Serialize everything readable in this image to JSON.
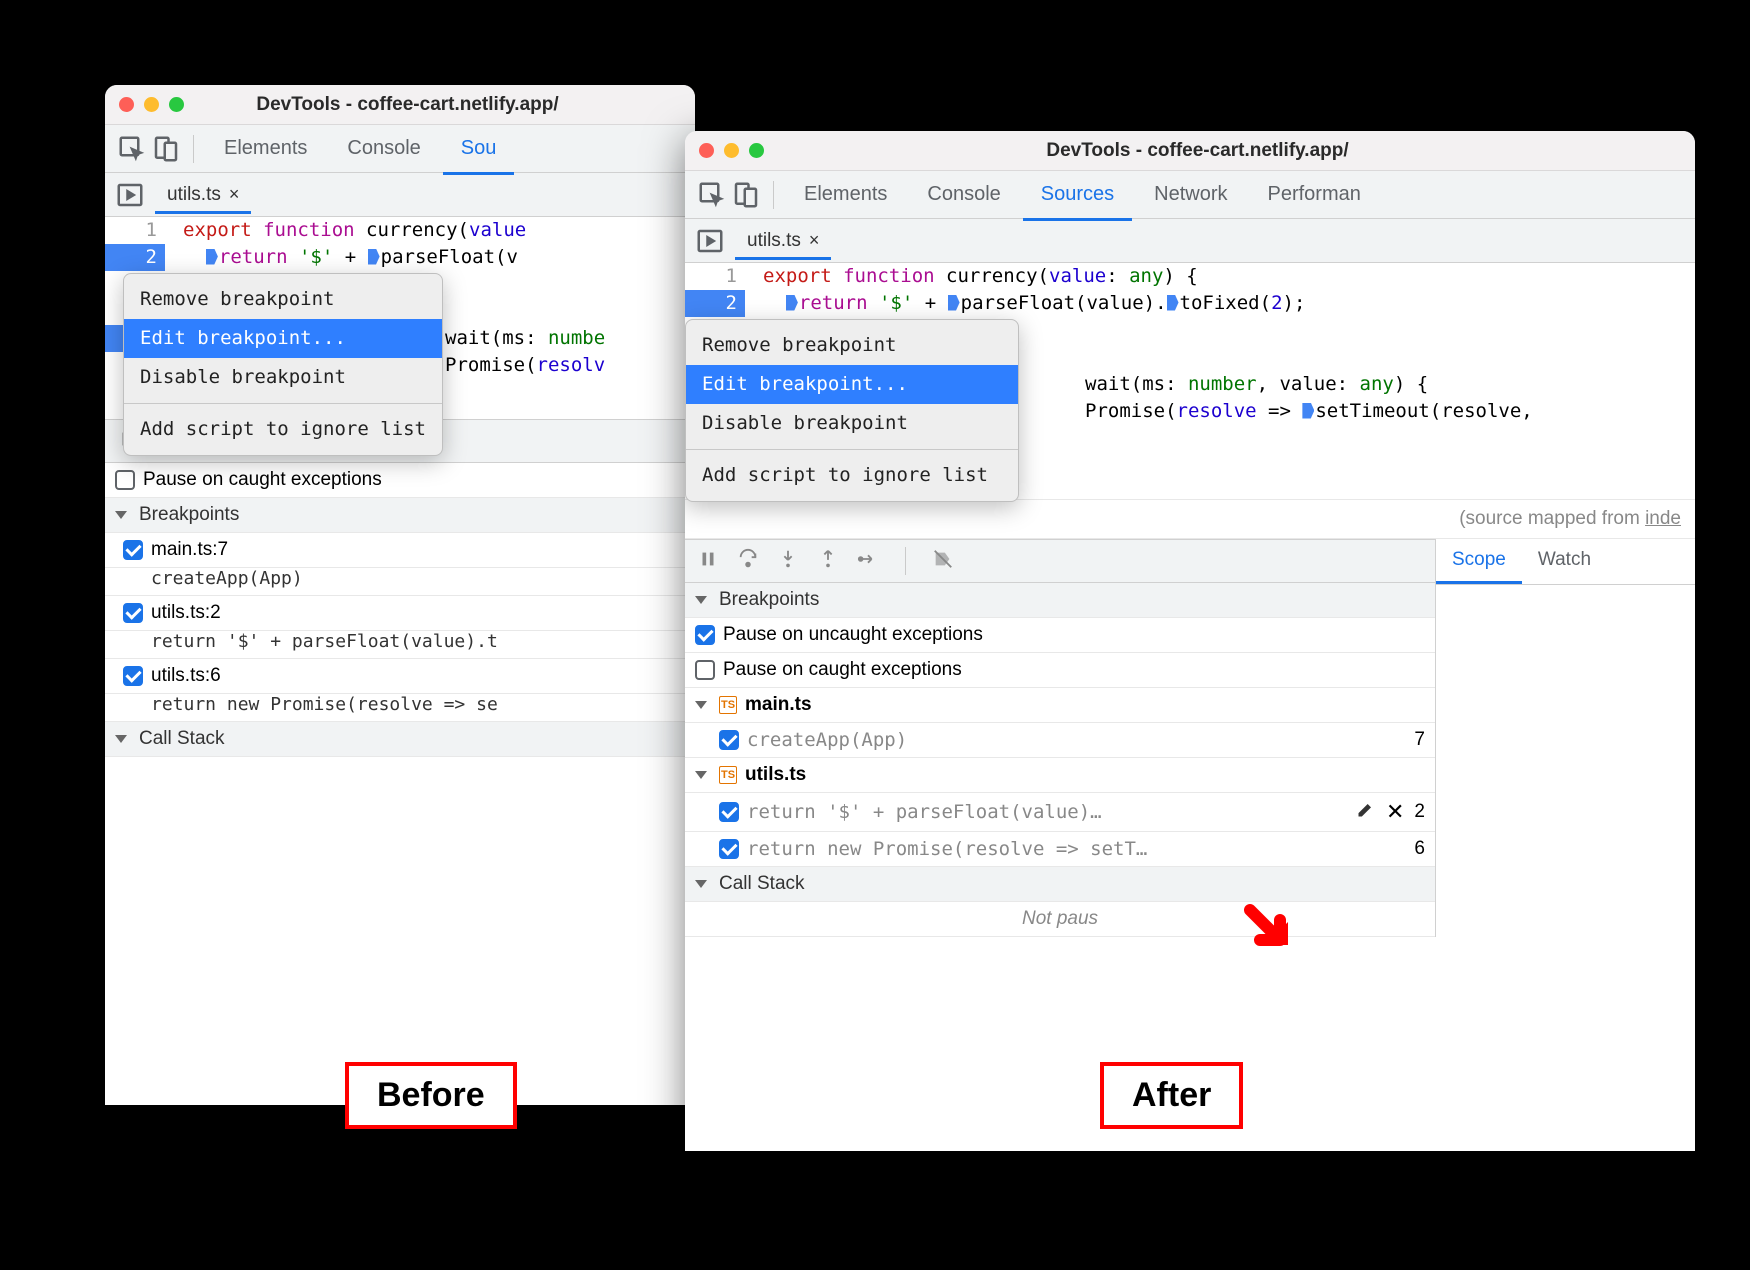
{
  "before": {
    "title": "DevTools - coffee-cart.netlify.app/",
    "tabs": [
      "Elements",
      "Console",
      "Sou"
    ],
    "file_tab": "utils.ts",
    "code": {
      "line1": {
        "num": "1",
        "tokens": [
          "export ",
          "function ",
          "currency",
          "(",
          "value"
        ]
      },
      "line2": {
        "num": "2",
        "tokens": [
          "return ",
          "'$'",
          " + ",
          "parseFloat",
          "(v"
        ]
      },
      "wait_line": {
        "tokens": [
          "wait(ms: ",
          "numbe"
        ]
      },
      "promise_line": {
        "tokens": [
          "Promise(",
          "resolv"
        ]
      }
    },
    "menu": {
      "remove": "Remove breakpoint",
      "edit": "Edit breakpoint...",
      "disable": "Disable breakpoint",
      "ignore": "Add script to ignore list"
    },
    "pause_caught": "Pause on caught exceptions",
    "breakpoints_header": "Breakpoints",
    "bp_items": [
      {
        "label": "main.ts:7",
        "snippet": "createApp(App)"
      },
      {
        "label": "utils.ts:2",
        "snippet": "return '$' + parseFloat(value).t"
      },
      {
        "label": "utils.ts:6",
        "snippet": "return new Promise(resolve => se"
      }
    ],
    "call_stack": "Call Stack",
    "label": "Before"
  },
  "after": {
    "title": "DevTools - coffee-cart.netlify.app/",
    "tabs": [
      "Elements",
      "Console",
      "Sources",
      "Network",
      "Performan"
    ],
    "active_tab": "Sources",
    "file_tab": "utils.ts",
    "code": {
      "line1": {
        "num": "1",
        "tokens": [
          "export ",
          "function ",
          "currency",
          "(",
          "value",
          ": ",
          "any",
          ") {"
        ]
      },
      "line2": {
        "num": "2",
        "tokens": [
          "return ",
          "'$'",
          " + ",
          "parseFloat",
          "(value).",
          "toFixed",
          "(",
          "2",
          ");"
        ]
      },
      "wait_line": {
        "tokens": [
          "wait(ms: ",
          "number",
          ", value: ",
          "any",
          ") {"
        ]
      },
      "promise_line": {
        "tokens": [
          "Promise(",
          "resolve",
          " => ",
          "setTimeout",
          "(resolve,"
        ]
      }
    },
    "menu": {
      "remove": "Remove breakpoint",
      "edit": "Edit breakpoint...",
      "disable": "Disable breakpoint",
      "ignore": "Add script to ignore list"
    },
    "source_mapped": "(source mapped from inde",
    "scope_tab": "Scope",
    "watch_tab": "Watch",
    "breakpoints_header": "Breakpoints",
    "pause_uncaught": "Pause on uncaught exceptions",
    "pause_caught": "Pause on caught exceptions",
    "groups": [
      {
        "file": "main.ts",
        "items": [
          {
            "snippet": "createApp(App)",
            "line": "7"
          }
        ]
      },
      {
        "file": "utils.ts",
        "items": [
          {
            "snippet": "return '$' + parseFloat(value)…",
            "line": "2",
            "actions": true
          },
          {
            "snippet": "return new Promise(resolve => setT…",
            "line": "6"
          }
        ]
      }
    ],
    "call_stack": "Call Stack",
    "not_paused": "Not paus",
    "label": "After"
  }
}
